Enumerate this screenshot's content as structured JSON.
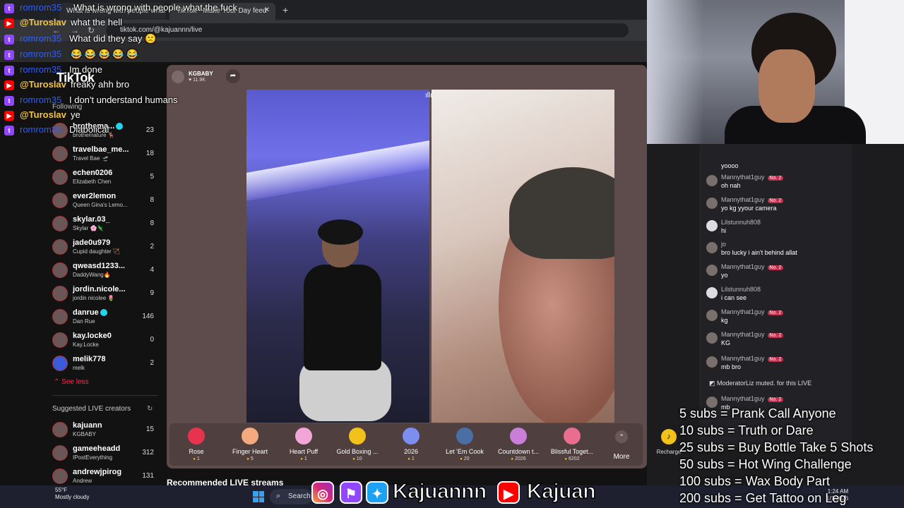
{
  "browser": {
    "tabs": [
      {
        "label": "What is wrong with people what the fuck"
      },
      {
        "label": "TikTok - Make Your Day feed"
      }
    ],
    "url": "tiktok.com/@kajuannn/live"
  },
  "tiktok": {
    "logo": "TikTok",
    "following_header": "Following",
    "following": [
      {
        "name": "brothema...",
        "sub": "brothemature 🦌",
        "count": "23",
        "verified": true
      },
      {
        "name": "travelbae_me...",
        "sub": "Travel Bae 🛫",
        "count": "18"
      },
      {
        "name": "echen0206",
        "sub": "Elizabeth Chen",
        "count": "5"
      },
      {
        "name": "ever2lemon",
        "sub": "Queen Gina's Lemo...",
        "count": "8"
      },
      {
        "name": "skylar.03_",
        "sub": "Skylar 🌸🦎",
        "count": "8"
      },
      {
        "name": "jade0u979",
        "sub": "Cupid daughter 🏹",
        "count": "2"
      },
      {
        "name": "qweasd1233...",
        "sub": "DaddyWang🔥",
        "count": "4"
      },
      {
        "name": "jordin.nicole...",
        "sub": "jordin nicolee 🌷",
        "count": "9"
      },
      {
        "name": "danrue",
        "sub": "Dan Rue",
        "count": "146",
        "verified": true
      },
      {
        "name": "kay.locke0",
        "sub": "Kay.Locke",
        "count": "0"
      },
      {
        "name": "melik778",
        "sub": "melk",
        "count": "2"
      }
    ],
    "see_less": "See less",
    "suggested_header": "Suggested LIVE creators",
    "suggested": [
      {
        "name": "kajuann",
        "sub": "KGBABY",
        "count": "15"
      },
      {
        "name": "gameeheadd",
        "sub": "IPostEverything",
        "count": "312"
      },
      {
        "name": "andrewjpirog",
        "sub": "Andrew",
        "count": "131"
      }
    ],
    "host": {
      "name": "KGBABY",
      "likes": "♥ 11.9K"
    },
    "gifts": [
      {
        "name": "Rose",
        "price": "1",
        "color": "#e8334f"
      },
      {
        "name": "Finger Heart",
        "price": "5",
        "color": "#f5a97f"
      },
      {
        "name": "Heart Puff",
        "price": "1",
        "color": "#f2a6d8"
      },
      {
        "name": "Gold Boxing ...",
        "price": "10",
        "color": "#f2c21a"
      },
      {
        "name": "2026",
        "price": "1",
        "color": "#7c8ef0"
      },
      {
        "name": "Let 'Em Cook",
        "price": "20",
        "color": "#4a6fa5"
      },
      {
        "name": "Countdown t...",
        "price": "2026",
        "color": "#c97fd8"
      },
      {
        "name": "Blissful Toget...",
        "price": "6202",
        "color": "#e86d8f"
      }
    ],
    "more_label": "More",
    "recharge_label": "Recharge",
    "recommended": "Recommended LIVE streams"
  },
  "live_chat": [
    {
      "user": "",
      "text": "yoooo",
      "badge": ""
    },
    {
      "user": "Mannythat1guy",
      "text": "oh nah",
      "badge": "No. 2"
    },
    {
      "user": "Mannythat1guy",
      "text": "yo kg yyour camera",
      "badge": "No. 2"
    },
    {
      "user": "Lilstunnuh808",
      "text": "hi",
      "badge": ""
    },
    {
      "user": "jo",
      "text": "bro lucky i ain't behind allat",
      "badge": ""
    },
    {
      "user": "Mannythat1guy",
      "text": "yo",
      "badge": "No. 2"
    },
    {
      "user": "Lilstunnuh808",
      "text": "i can see",
      "badge": ""
    },
    {
      "user": "Mannythat1guy",
      "text": "kg",
      "badge": "No. 2"
    },
    {
      "user": "Mannythat1guy",
      "text": "KG",
      "badge": "No. 2"
    },
    {
      "user": "Mannythat1guy",
      "text": "mb bro",
      "badge": "No. 2"
    },
    {
      "user": "Mannythat1guy",
      "text": "mb",
      "badge": "No. 2"
    }
  ],
  "mod_message": "ModeratorLiz muted. for this LIVE",
  "overlay_chat": [
    {
      "platform": "twitch",
      "user": "romrom35",
      "text": "What is wrong with people what the fuck"
    },
    {
      "platform": "youtube",
      "user": "@Turoslav",
      "text": "what the hell"
    },
    {
      "platform": "twitch",
      "user": "romrom35",
      "text": "What did they say 🙁"
    },
    {
      "platform": "twitch",
      "user": "romrom35",
      "text": "😂 😂 😂 😂 😂"
    },
    {
      "platform": "twitch",
      "user": "romrom35",
      "text": "Im done"
    },
    {
      "platform": "youtube",
      "user": "@Turoslav",
      "text": "freaky ahh bro"
    },
    {
      "platform": "twitch",
      "user": "romrom35",
      "text": "I don't understand humans"
    },
    {
      "platform": "youtube",
      "user": "@Turoslav",
      "text": "ye"
    },
    {
      "platform": "twitch",
      "user": "romrom35",
      "text": "Diabolical"
    }
  ],
  "subs_goals": [
    "5 subs = Prank Call Anyone",
    "10 subs = Truth or Dare",
    "25 subs = Buy Bottle Take 5 Shots",
    "50 subs = Hot Wing Challenge",
    "100 subs = Wax Body Part",
    "200 subs = Get Tattoo on Leg"
  ],
  "social_banner": {
    "handle_1": "Kajuannn",
    "handle_2": "Kajuan"
  },
  "taskbar": {
    "weather_temp": "55°F",
    "weather_desc": "Mostly cloudy",
    "search_label": "Search",
    "time": "1:24 AM",
    "date": "1/1/2026"
  }
}
